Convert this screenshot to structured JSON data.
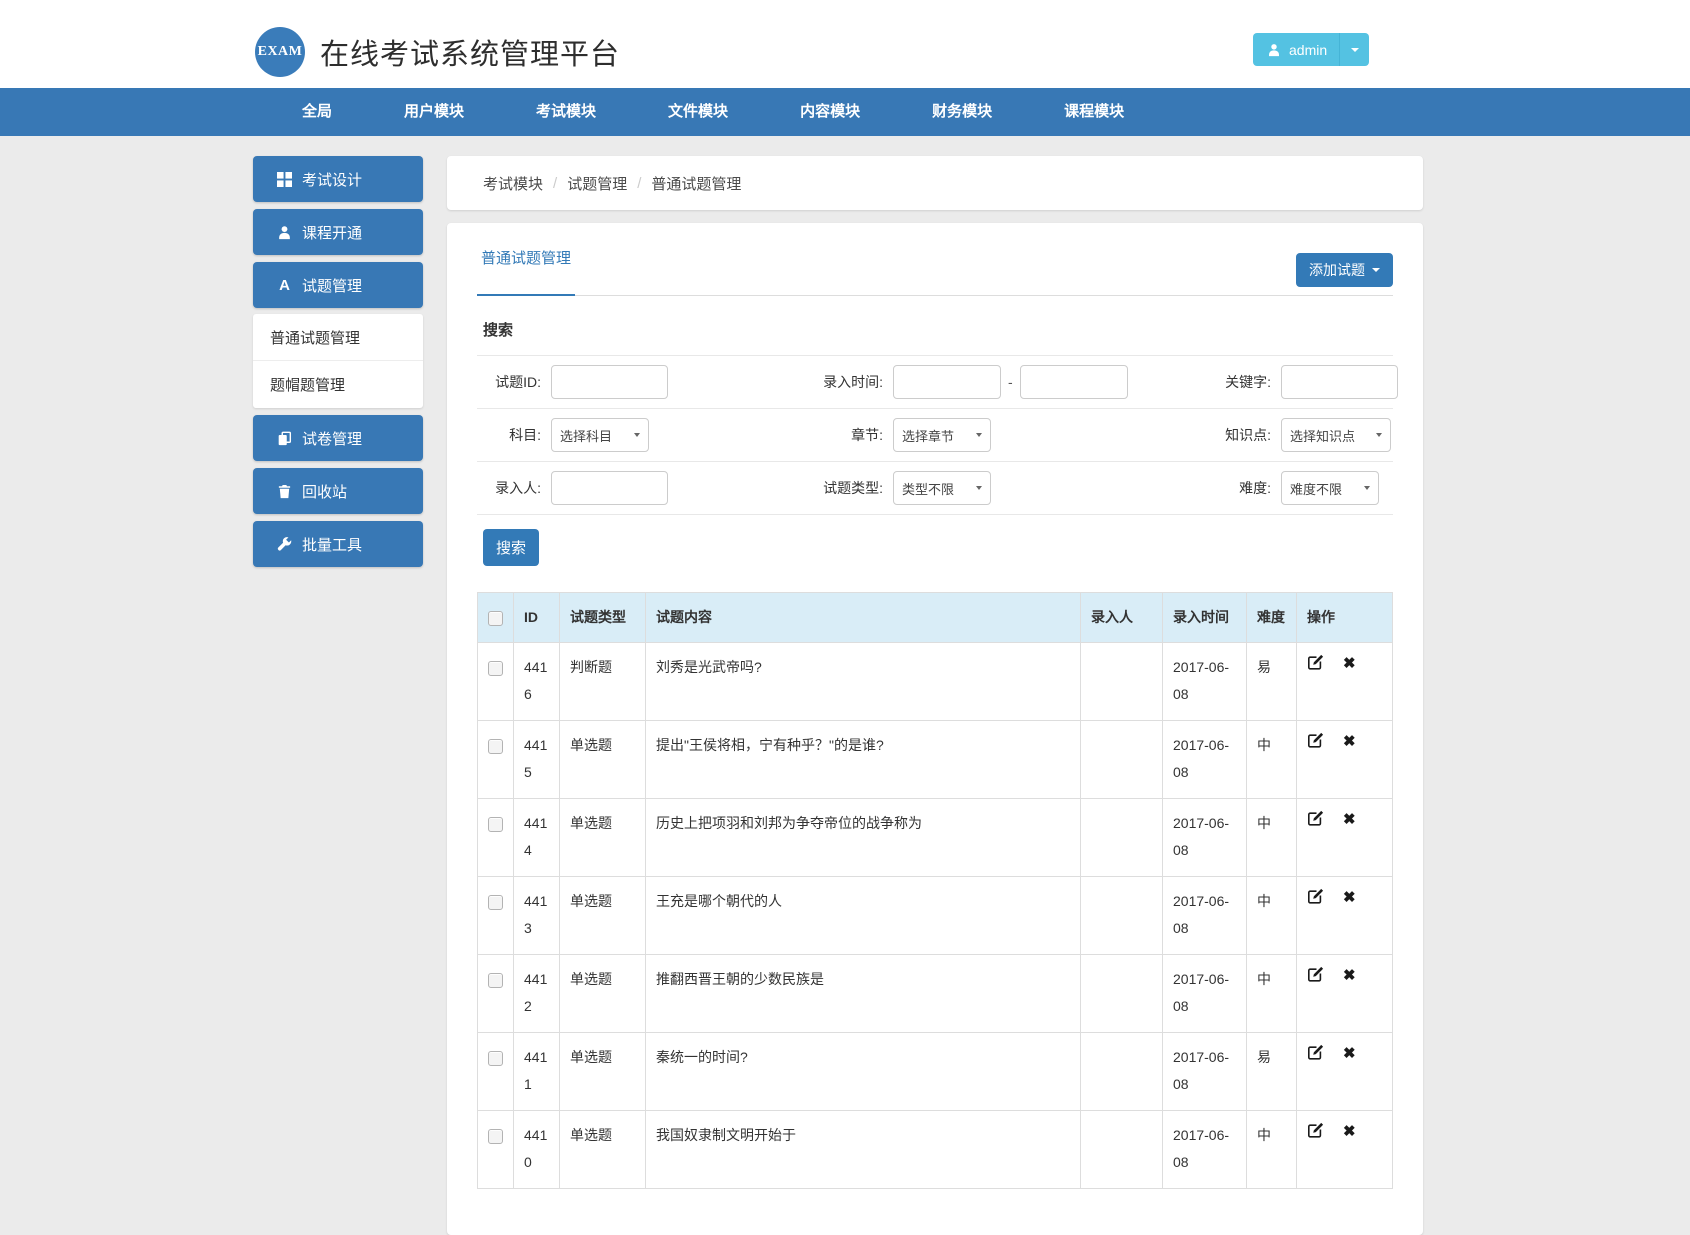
{
  "header": {
    "logo_text": "EXAM",
    "title": "在线考试系统管理平台",
    "user_button": {
      "label": "admin"
    }
  },
  "nav": {
    "items": [
      {
        "label": "全局",
        "active": false
      },
      {
        "label": "用户模块",
        "active": false
      },
      {
        "label": "考试模块",
        "active": true
      },
      {
        "label": "文件模块",
        "active": false
      },
      {
        "label": "内容模块",
        "active": false
      },
      {
        "label": "财务模块",
        "active": false
      },
      {
        "label": "课程模块",
        "active": false
      }
    ]
  },
  "sidebar": {
    "buttons": [
      {
        "label": "考试设计",
        "icon": "grid-icon"
      },
      {
        "label": "课程开通",
        "icon": "user-icon"
      },
      {
        "label": "试题管理",
        "icon": "font-a-icon",
        "expanded": true
      },
      {
        "label": "试卷管理",
        "icon": "copy-icon"
      },
      {
        "label": "回收站",
        "icon": "trash-icon"
      },
      {
        "label": "批量工具",
        "icon": "wrench-icon"
      }
    ],
    "submenu_items": [
      {
        "label": "普通试题管理",
        "active": true
      },
      {
        "label": "题帽题管理",
        "active": false
      }
    ]
  },
  "breadcrumb": {
    "separator": "/",
    "items": [
      "考试模块",
      "试题管理",
      "普通试题管理"
    ]
  },
  "panel": {
    "tab_label": "普通试题管理",
    "add_button_label": "添加试题"
  },
  "search": {
    "title": "搜索",
    "submit_label": "搜索",
    "question_id_label": "试题ID:",
    "entry_time_label": "录入时间:",
    "entry_time_separator": "-",
    "keyword_label": "关键字:",
    "subject_label": "科目:",
    "subject_value": "选择科目",
    "chapter_label": "章节:",
    "chapter_value": "选择章节",
    "knowledge_label": "知识点:",
    "knowledge_value": "选择知识点",
    "enterer_label": "录入人:",
    "type_label": "试题类型:",
    "type_value": "类型不限",
    "difficulty_label": "难度:",
    "difficulty_value": "难度不限"
  },
  "table": {
    "columns": [
      "ID",
      "试题类型",
      "试题内容",
      "录入人",
      "录入时间",
      "难度",
      "操作"
    ],
    "rows": [
      {
        "id": "4416",
        "type": "判断题",
        "content": "刘秀是光武帝吗?",
        "enterer": "",
        "time": "2017-06-08",
        "difficulty": "易"
      },
      {
        "id": "4415",
        "type": "单选题",
        "content": "提出\"王侯将相，宁有种乎？\"的是谁?",
        "enterer": "",
        "time": "2017-06-08",
        "difficulty": "中"
      },
      {
        "id": "4414",
        "type": "单选题",
        "content": "历史上把项羽和刘邦为争夺帝位的战争称为",
        "enterer": "",
        "time": "2017-06-08",
        "difficulty": "中"
      },
      {
        "id": "4413",
        "type": "单选题",
        "content": "王充是哪个朝代的人",
        "enterer": "",
        "time": "2017-06-08",
        "difficulty": "中"
      },
      {
        "id": "4412",
        "type": "单选题",
        "content": "推翻西晋王朝的少数民族是",
        "enterer": "",
        "time": "2017-06-08",
        "difficulty": "中"
      },
      {
        "id": "4411",
        "type": "单选题",
        "content": "秦统一的时间?",
        "enterer": "",
        "time": "2017-06-08",
        "difficulty": "易"
      },
      {
        "id": "4410",
        "type": "单选题",
        "content": "我国奴隶制文明开始于",
        "enterer": "",
        "time": "2017-06-08",
        "difficulty": "中"
      }
    ]
  },
  "icons": {
    "delete_glyph": "✖",
    "font_a_glyph": "A"
  },
  "colors": {
    "nav_blue": "#3878b5",
    "button_blue": "#337ab7",
    "admin_button_blue": "#54c2e2",
    "logo_blue": "#3a7cba",
    "table_header_bg": "#d9edf7",
    "page_bg": "#ebebeb",
    "card_bg": "#ffffff",
    "border": "#dddddd"
  }
}
